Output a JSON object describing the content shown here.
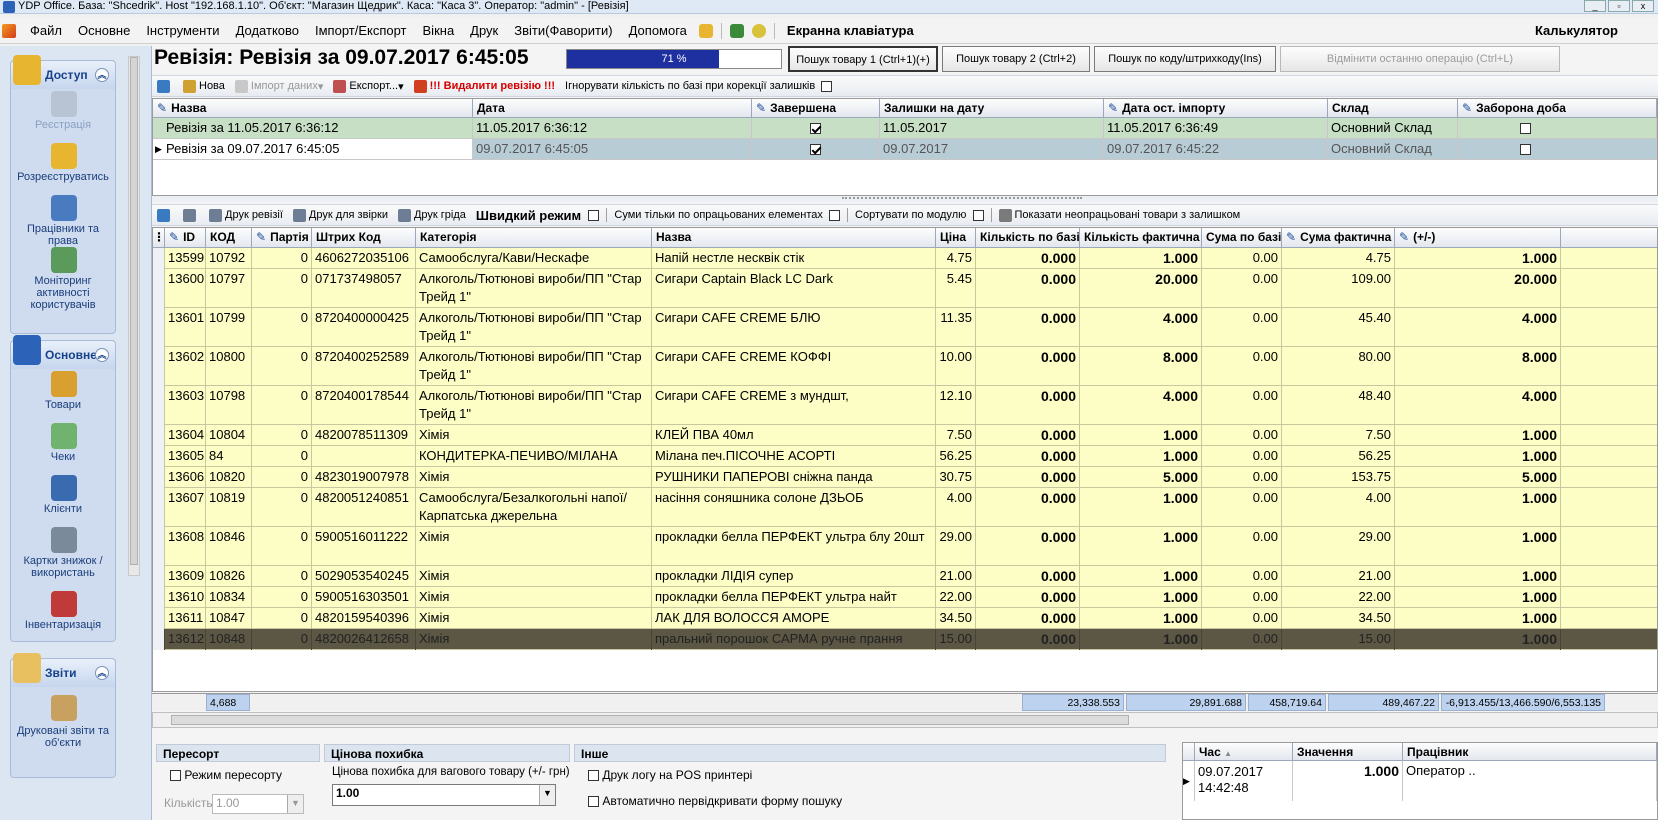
{
  "window": {
    "title": "YDP Office. База: \"Shcedrik\". Host \"192.168.1.10\". Об'єкт: \"Магазин Щедрик\". Каса: \"Каса 3\". Оператор: \"admin\" - [Ревізія]"
  },
  "menu": {
    "items": [
      "Файл",
      "Основне",
      "Інструменти",
      "Додатково",
      "Імпорт/Експорт",
      "Вікна",
      "Друк",
      "Звіти(Фаворити)",
      "Допомога"
    ],
    "keyboard": "Екранна клавіатура",
    "calculator": "Калькулятор"
  },
  "sidebar": {
    "groups": [
      {
        "title": "Доступ",
        "items": [
          "Реєстрація",
          "Розреєструватись",
          "Працівники та права",
          "Моніторинг активності користувачів"
        ]
      },
      {
        "title": "Основне",
        "items": [
          "Товари",
          "Чеки",
          "Клієнти",
          "Картки знижок / використань",
          "Інвентаризація"
        ]
      },
      {
        "title": "Звіти",
        "items": [
          "Друковані звіти та об'єкти"
        ]
      }
    ]
  },
  "header": {
    "title": "Ревізія: Ревізія за 09.07.2017 6:45:05",
    "progress_label": "71 %",
    "progress_value": 0.71,
    "btn_search1": "Пошук товару 1 (Ctrl+1)(+)",
    "btn_search2": "Пошук товару 2 (Ctrl+2)",
    "btn_search_code": "Пошук по коду/штрихкоду(Ins)",
    "btn_undo": "Відмінити останню операцію (Ctrl+L)"
  },
  "toolbar1": {
    "new": "Нова",
    "import": "Імпорт даних",
    "export": "Експорт...",
    "delete": "!!! Видалити ревізію !!!",
    "ignore": "Ігнорувати кількість по базі при корекції  залишків"
  },
  "revisions": {
    "columns": [
      "Назва",
      "Дата",
      "Завершена",
      "Залишки на дату",
      "Дата ост. імпорту",
      "Склад",
      "Заборона доба"
    ],
    "rows": [
      {
        "name": "Ревізія за 11.05.2017 6:36:12",
        "date": "11.05.2017 6:36:12",
        "done": true,
        "stock_date": "11.05.2017",
        "import": "11.05.2017 6:36:49",
        "warehouse": "Основний Склад",
        "forbid": false
      },
      {
        "name": "Ревізія за 09.07.2017 6:45:05",
        "date": "09.07.2017 6:45:05",
        "done": true,
        "stock_date": "09.07.2017",
        "import": "09.07.2017 6:45:22",
        "warehouse": "Основний Склад",
        "forbid": false
      }
    ]
  },
  "toolbar2": {
    "print_rev": "Друк ревізії",
    "print_check": "Друк для звірки",
    "print_grid": "Друк гріда",
    "quick": "Швидкий режим",
    "sums_only": "Суми тільки по опрацьованих  елементах",
    "sort_mod": "Сортувати по модулю",
    "show_unproc": "Показати неопрацьовані товари з залишком"
  },
  "items": {
    "columns": [
      "ID",
      "КОД",
      "Партія",
      "Штрих Код",
      "Категорія",
      "Назва",
      "Ціна",
      "Кількість по базі",
      "Кількість фактична",
      "Сума по базі",
      "Сума фактична",
      "(+/-)"
    ],
    "rows": [
      {
        "id": "13599",
        "code": "10792",
        "batch": "0",
        "barcode": "4606272035106",
        "cat": "Самообслуга/Кави/Нескафе",
        "name": "Напій нестле несквік стік",
        "price": "4.75",
        "qb": "0.000",
        "qf": "1.000",
        "sb": "0.00",
        "sf": "4.75",
        "diff": "1.000"
      },
      {
        "id": "13600",
        "code": "10797",
        "batch": "0",
        "barcode": "071737498057",
        "cat": "Алкоголь/Тютюнові вироби/ПП \"Стар Трейд 1\"",
        "name": "Сигари Captain Black LC Dark",
        "price": "5.45",
        "qb": "0.000",
        "qf": "20.000",
        "sb": "0.00",
        "sf": "109.00",
        "diff": "20.000"
      },
      {
        "id": "13601",
        "code": "10799",
        "batch": "0",
        "barcode": "8720400000425",
        "cat": "Алкоголь/Тютюнові вироби/ПП \"Стар Трейд 1\"",
        "name": "Сигари CAFE CREME БЛЮ",
        "price": "11.35",
        "qb": "0.000",
        "qf": "4.000",
        "sb": "0.00",
        "sf": "45.40",
        "diff": "4.000"
      },
      {
        "id": "13602",
        "code": "10800",
        "batch": "0",
        "barcode": "8720400252589",
        "cat": "Алкоголь/Тютюнові вироби/ПП \"Стар Трейд 1\"",
        "name": "Сигари CAFE CREME КОФФІ",
        "price": "10.00",
        "qb": "0.000",
        "qf": "8.000",
        "sb": "0.00",
        "sf": "80.00",
        "diff": "8.000"
      },
      {
        "id": "13603",
        "code": "10798",
        "batch": "0",
        "barcode": "8720400178544",
        "cat": "Алкоголь/Тютюнові вироби/ПП \"Стар Трейд 1\"",
        "name": "Сигари CAFE CREME з мундшт,",
        "price": "12.10",
        "qb": "0.000",
        "qf": "4.000",
        "sb": "0.00",
        "sf": "48.40",
        "diff": "4.000"
      },
      {
        "id": "13604",
        "code": "10804",
        "batch": "0",
        "barcode": "4820078511309",
        "cat": "Хімія",
        "name": "КЛЕЙ ПВА 40мл",
        "price": "7.50",
        "qb": "0.000",
        "qf": "1.000",
        "sb": "0.00",
        "sf": "7.50",
        "diff": "1.000"
      },
      {
        "id": "13605",
        "code": "84",
        "batch": "0",
        "barcode": "",
        "cat": "КОНДИТЕРКА-ПЕЧИВО/МІЛАНА",
        "name": "Мілана печ.ПІСОЧНЕ АСОРТІ",
        "price": "56.25",
        "qb": "0.000",
        "qf": "1.000",
        "sb": "0.00",
        "sf": "56.25",
        "diff": "1.000"
      },
      {
        "id": "13606",
        "code": "10820",
        "batch": "0",
        "barcode": "4823019007978",
        "cat": "Хімія",
        "name": "РУШНИКИ ПАПЕРОВІ  сніжна панда",
        "price": "30.75",
        "qb": "0.000",
        "qf": "5.000",
        "sb": "0.00",
        "sf": "153.75",
        "diff": "5.000"
      },
      {
        "id": "13607",
        "code": "10819",
        "batch": "0",
        "barcode": "4820051240851",
        "cat": "Самообслуга/Безалкогольні напої/Карпатська джерельна",
        "name": "насіння соняшника солоне ДЗЬОБ",
        "price": "4.00",
        "qb": "0.000",
        "qf": "1.000",
        "sb": "0.00",
        "sf": "4.00",
        "diff": "1.000"
      },
      {
        "id": "13608",
        "code": "10846",
        "batch": "0",
        "barcode": "5900516011222",
        "cat": "Хімія",
        "name": "прокладки белла ПЕРФЕКТ ультра блу 20шт",
        "price": "29.00",
        "qb": "0.000",
        "qf": "1.000",
        "sb": "0.00",
        "sf": "29.00",
        "diff": "1.000"
      },
      {
        "id": "13609",
        "code": "10826",
        "batch": "0",
        "barcode": "5029053540245",
        "cat": "Хімія",
        "name": "прокладки ЛІДІЯ супер",
        "price": "21.00",
        "qb": "0.000",
        "qf": "1.000",
        "sb": "0.00",
        "sf": "21.00",
        "diff": "1.000"
      },
      {
        "id": "13610",
        "code": "10834",
        "batch": "0",
        "barcode": "5900516303501",
        "cat": "Хімія",
        "name": "прокладки белла ПЕРФЕКТ ультра найт",
        "price": "22.00",
        "qb": "0.000",
        "qf": "1.000",
        "sb": "0.00",
        "sf": "22.00",
        "diff": "1.000"
      },
      {
        "id": "13611",
        "code": "10847",
        "batch": "0",
        "barcode": "4820159540396",
        "cat": "Хімія",
        "name": "ЛАК ДЛЯ ВОЛОССЯ АМОРЕ",
        "price": "34.50",
        "qb": "0.000",
        "qf": "1.000",
        "sb": "0.00",
        "sf": "34.50",
        "diff": "1.000"
      },
      {
        "id": "13612",
        "code": "10848",
        "batch": "0",
        "barcode": "4820026412658",
        "cat": "Хімія",
        "name": "пральний порошок САРМА ручне прання",
        "price": "15.00",
        "qb": "0.000",
        "qf": "1.000",
        "sb": "0.00",
        "sf": "15.00",
        "diff": "1.000"
      }
    ],
    "footer": {
      "count": "4,688",
      "qb": "23,338.553",
      "qf": "29,891.688",
      "sb": "458,719.64",
      "sf": "489,467.22",
      "diff": "-6,913.455/13,466.590/6,553.135"
    }
  },
  "bottom": {
    "resort_title": "Пересорт",
    "resort_mode": "Режим пересорту",
    "qty_label": "Кількість",
    "qty_value": "1.00",
    "price_title": "Цінова похибка",
    "price_label": "Цінова похибка для вагового товару (+/- грн)",
    "price_value": "1.00",
    "other_title": "Інше",
    "print_log": "Друк логу на POS принтері",
    "auto_reopen": "Автоматично первідкривати форму пошуку"
  },
  "log": {
    "columns": [
      "Час",
      "Значення",
      "Працівник"
    ],
    "rows": [
      {
        "time": "09.07.2017 14:42:48",
        "value": "1.000",
        "worker": "Оператор .."
      }
    ]
  }
}
